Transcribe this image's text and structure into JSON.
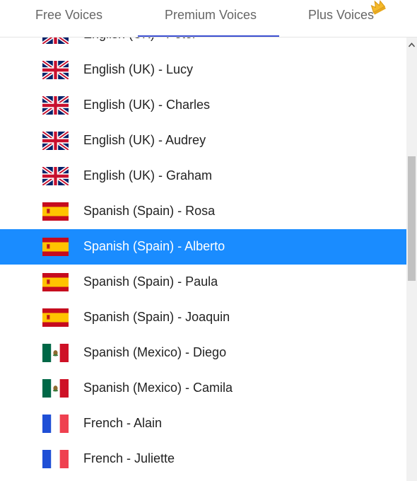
{
  "tabs": {
    "free": "Free Voices",
    "premium": "Premium Voices",
    "plus": "Plus Voices",
    "active": "premium",
    "accent_color": "#3c4fd0"
  },
  "selected_color": "#1a8cff",
  "voices": [
    {
      "label": "English (UK) - Peter",
      "flag": "uk-flag-icon"
    },
    {
      "label": "English (UK) - Lucy",
      "flag": "uk-flag-icon"
    },
    {
      "label": "English (UK) - Charles",
      "flag": "uk-flag-icon"
    },
    {
      "label": "English (UK) - Audrey",
      "flag": "uk-flag-icon"
    },
    {
      "label": "English (UK) - Graham",
      "flag": "uk-flag-icon"
    },
    {
      "label": "Spanish (Spain) - Rosa",
      "flag": "spain-flag-icon"
    },
    {
      "label": "Spanish (Spain) - Alberto",
      "flag": "spain-flag-icon",
      "selected": true
    },
    {
      "label": "Spanish (Spain) - Paula",
      "flag": "spain-flag-icon"
    },
    {
      "label": "Spanish (Spain) - Joaquin",
      "flag": "spain-flag-icon"
    },
    {
      "label": "Spanish (Mexico) - Diego",
      "flag": "mexico-flag-icon"
    },
    {
      "label": "Spanish (Mexico) - Camila",
      "flag": "mexico-flag-icon"
    },
    {
      "label": "French - Alain",
      "flag": "france-flag-icon"
    },
    {
      "label": "French - Juliette",
      "flag": "france-flag-icon"
    }
  ]
}
